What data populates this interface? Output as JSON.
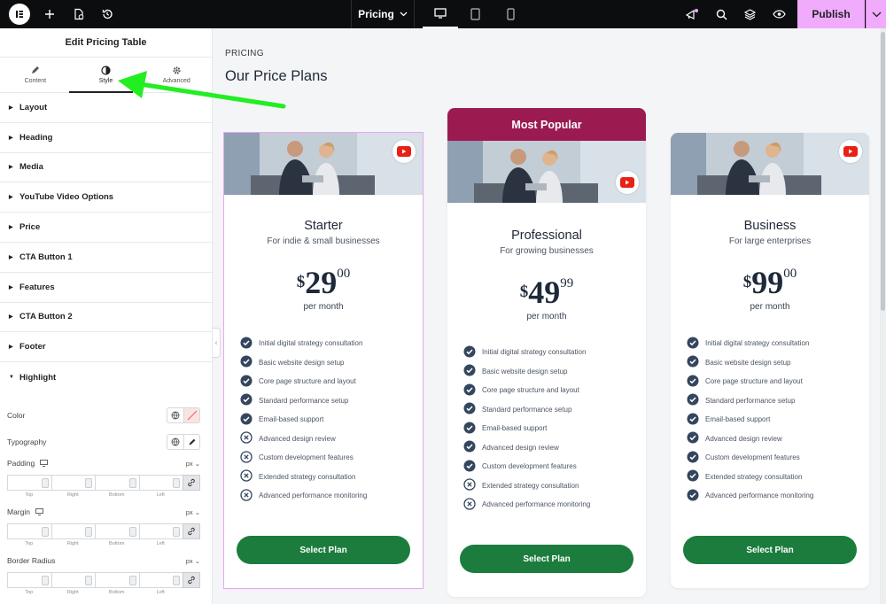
{
  "topbar": {
    "page_name": "Pricing",
    "publish_label": "Publish"
  },
  "panel": {
    "title": "Edit Pricing Table",
    "tabs": [
      {
        "label": "Content",
        "icon": "pencil-icon"
      },
      {
        "label": "Style",
        "icon": "contrast-icon"
      },
      {
        "label": "Advanced",
        "icon": "gear-icon"
      }
    ],
    "active_tab": "Style",
    "sections": [
      "Layout",
      "Heading",
      "Media",
      "YouTube Video Options",
      "Price",
      "CTA Button 1",
      "Features",
      "CTA Button 2",
      "Footer",
      "Highlight"
    ],
    "open_section": "Highlight",
    "controls": {
      "color_label": "Color",
      "typography_label": "Typography",
      "padding_label": "Padding",
      "margin_label": "Margin",
      "border_radius_label": "Border Radius",
      "unit": "px",
      "dim_labels": [
        "Top",
        "Right",
        "Bottom",
        "Left"
      ]
    }
  },
  "canvas": {
    "pre_title": "PRICING",
    "title": "Our Price Plans",
    "plans": [
      {
        "name": "Starter",
        "subtitle": "For indie & small businesses",
        "currency": "$",
        "price_int": "29",
        "price_frac": "00",
        "period": "per month",
        "ribbon": "",
        "button": "Select Plan",
        "features": [
          {
            "text": "Initial digital strategy consultation",
            "included": true
          },
          {
            "text": "Basic website design setup",
            "included": true
          },
          {
            "text": "Core page structure and layout",
            "included": true
          },
          {
            "text": "Standard performance setup",
            "included": true
          },
          {
            "text": "Email-based support",
            "included": true
          },
          {
            "text": "Advanced design review",
            "included": false
          },
          {
            "text": "Custom development features",
            "included": false
          },
          {
            "text": "Extended strategy consultation",
            "included": false
          },
          {
            "text": "Advanced performance monitoring",
            "included": false
          }
        ]
      },
      {
        "name": "Professional",
        "subtitle": "For growing businesses",
        "currency": "$",
        "price_int": "49",
        "price_frac": "99",
        "period": "per month",
        "ribbon": "Most Popular",
        "button": "Select Plan",
        "features": [
          {
            "text": "Initial digital strategy consultation",
            "included": true
          },
          {
            "text": "Basic website design setup",
            "included": true
          },
          {
            "text": "Core page structure and layout",
            "included": true
          },
          {
            "text": "Standard performance setup",
            "included": true
          },
          {
            "text": "Email-based support",
            "included": true
          },
          {
            "text": "Advanced design review",
            "included": true
          },
          {
            "text": "Custom development features",
            "included": true
          },
          {
            "text": "Extended strategy consultation",
            "included": false
          },
          {
            "text": "Advanced performance monitoring",
            "included": false
          }
        ]
      },
      {
        "name": "Business",
        "subtitle": "For large enterprises",
        "currency": "$",
        "price_int": "99",
        "price_frac": "00",
        "period": "per month",
        "ribbon": "",
        "button": "Select Plan",
        "features": [
          {
            "text": "Initial digital strategy consultation",
            "included": true
          },
          {
            "text": "Basic website design setup",
            "included": true
          },
          {
            "text": "Core page structure and layout",
            "included": true
          },
          {
            "text": "Standard performance setup",
            "included": true
          },
          {
            "text": "Email-based support",
            "included": true
          },
          {
            "text": "Advanced design review",
            "included": true
          },
          {
            "text": "Custom development features",
            "included": true
          },
          {
            "text": "Extended strategy consultation",
            "included": true
          },
          {
            "text": "Advanced performance monitoring",
            "included": true
          }
        ]
      }
    ]
  },
  "colors": {
    "accent_pink": "#f0abfc",
    "ribbon": "#9b1b51",
    "button_green": "#1c7c3d",
    "check_blue": "#34465e",
    "annotation_arrow": "#22ee22"
  }
}
